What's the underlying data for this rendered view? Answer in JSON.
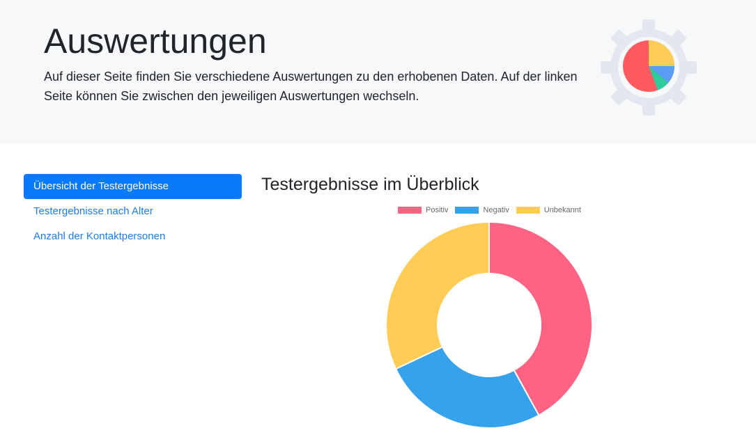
{
  "header": {
    "title": "Auswertungen",
    "description": "Auf dieser Seite finden Sie verschiedene Auswertungen zu den erhobenen Daten. Auf der linken Seite können Sie zwischen den jeweiligen Auswertungen wechseln.",
    "graphic_icon": "gear-pie-chart-icon"
  },
  "sidebar": {
    "items": [
      {
        "label": "Übersicht der Testergebnisse",
        "active": true
      },
      {
        "label": "Testergebnisse nach Alter",
        "active": false
      },
      {
        "label": "Anzahl der Kontaktpersonen",
        "active": false
      }
    ]
  },
  "main": {
    "section_title": "Testergebnisse im Überblick"
  },
  "colors": {
    "accent": "#0a7bf8",
    "positiv": "#ff6384",
    "negativ": "#36a2eb",
    "unbekannt": "#ffcd56"
  },
  "chart_data": {
    "type": "doughnut",
    "legend_position": "top",
    "categories": [
      "Positiv",
      "Negativ",
      "Unbekannt"
    ],
    "values": [
      42,
      26,
      32
    ],
    "colors": [
      "#ff6384",
      "#36a2eb",
      "#ffcd56"
    ]
  }
}
